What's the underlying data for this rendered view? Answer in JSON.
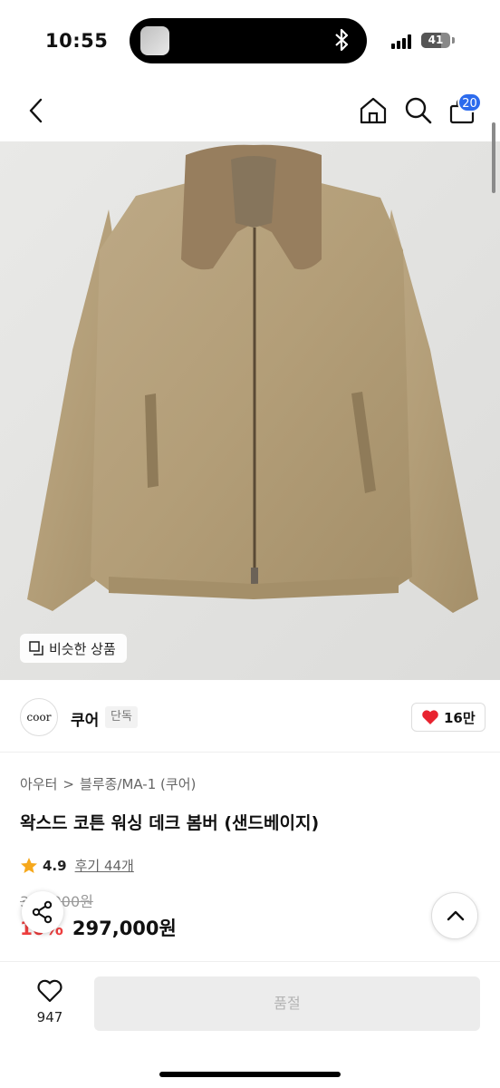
{
  "status_bar": {
    "time": "10:55",
    "battery": "41"
  },
  "nav": {
    "cart_count": "20"
  },
  "image": {
    "similar_label": "비슷한 상품"
  },
  "brand": {
    "logo_text": "coor",
    "name": "쿠어",
    "tag": "단독",
    "likes": "16만"
  },
  "breadcrumb": {
    "category": "아우터",
    "separator": ">",
    "subcategory": "블루종/MA-1 (쿠어)"
  },
  "product": {
    "title": "왁스드 코튼 워싱 데크 봄버 (샌드베이지)",
    "rating": "4.9",
    "reviews": "후기 44개",
    "original_price": "330,000원",
    "discount": "10%",
    "price": "297,000원"
  },
  "bottom": {
    "wish_count": "947",
    "cta": "품절"
  },
  "colors": {
    "accent": "#2c6bed",
    "discount": "#ee3e3e",
    "heart": "#e8232f",
    "star": "#f6a81c",
    "jacket": "#b6a07a"
  }
}
